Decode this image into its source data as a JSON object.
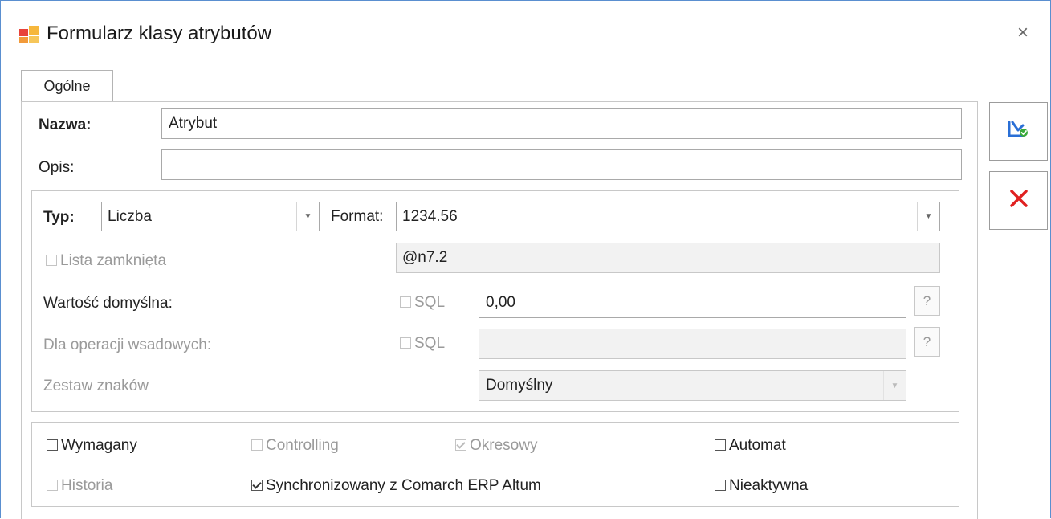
{
  "window": {
    "title": "Formularz klasy atrybutów",
    "close_symbol": "×"
  },
  "tabs": [
    {
      "label": "Ogólne",
      "active": true
    }
  ],
  "form": {
    "nazwa_label": "Nazwa:",
    "nazwa_value": "Atrybut",
    "opis_label": "Opis:",
    "opis_value": "",
    "typ_label": "Typ:",
    "typ_value": "Liczba",
    "format_label": "Format:",
    "format_value": "1234.56",
    "format_code": "@n7.2",
    "lista_zamknieta_label": "Lista zamknięta",
    "wartosc_domyslna_label": "Wartość domyślna:",
    "wartosc_sql_label": "SQL",
    "wartosc_value": "0,00",
    "wsadowe_label": "Dla operacji wsadowych:",
    "wsadowe_sql_label": "SQL",
    "wsadowe_value": "",
    "help_symbol": "?",
    "zestaw_label": "Zestaw znaków",
    "zestaw_value": "Domyślny"
  },
  "options": {
    "wymagany": {
      "label": "Wymagany",
      "checked": false,
      "enabled": true
    },
    "controlling": {
      "label": "Controlling",
      "checked": false,
      "enabled": false
    },
    "okresowy": {
      "label": "Okresowy",
      "checked": true,
      "enabled": false
    },
    "automat": {
      "label": "Automat",
      "checked": false,
      "enabled": true
    },
    "historia": {
      "label": "Historia",
      "checked": false,
      "enabled": false
    },
    "synchronizowany": {
      "label": "Synchronizowany z Comarch ERP Altum",
      "checked": true,
      "enabled": true
    },
    "nieaktywna": {
      "label": "Nieaktywna",
      "checked": false,
      "enabled": true
    }
  },
  "colors": {
    "window_border": "#5a8fd0",
    "save_icon": "#2a6fd6",
    "cancel_icon": "#e02020",
    "disabled_text": "#9a9a9a"
  },
  "icons": {
    "app": "app-icon",
    "save": "save-icon",
    "cancel": "cancel-icon"
  }
}
